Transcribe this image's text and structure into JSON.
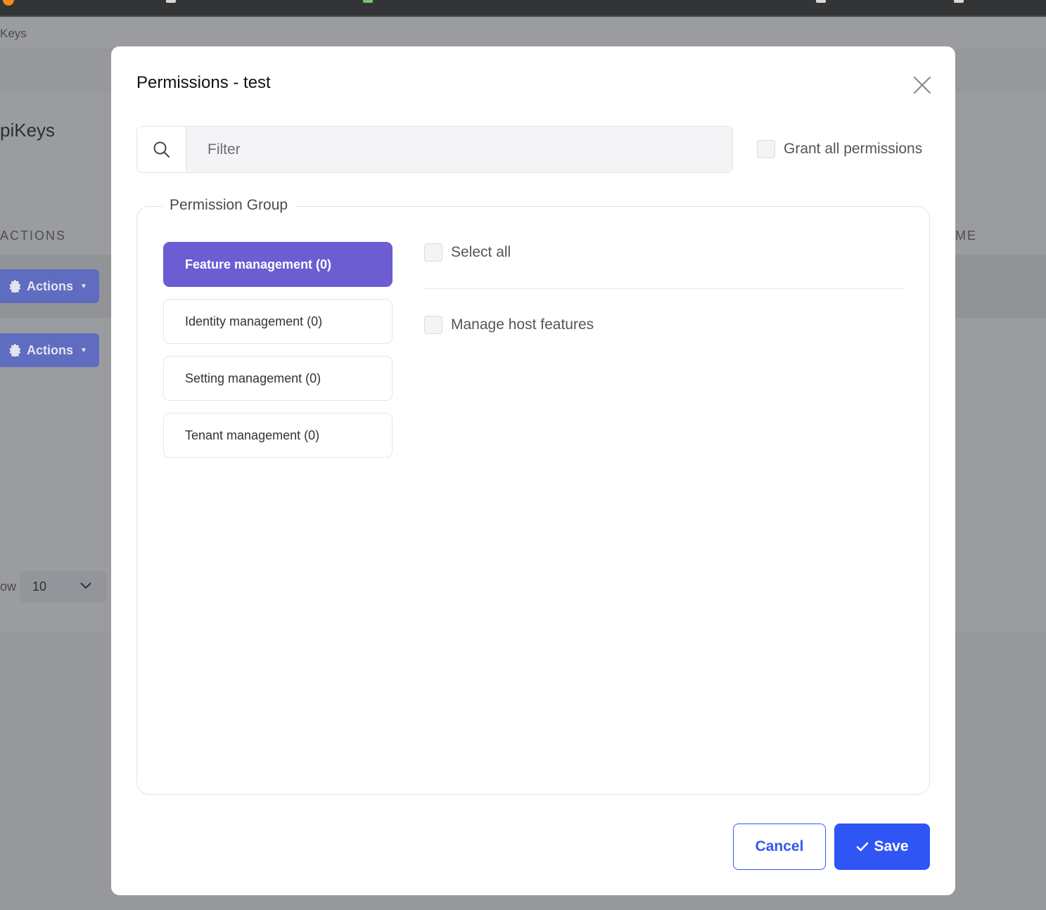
{
  "background": {
    "breadcrumb": "Keys",
    "page_title": "piKeys",
    "col_actions": "ACTIONS",
    "col_name": "ME",
    "actions_label": "Actions",
    "show_label": "ow",
    "page_size": "10"
  },
  "modal": {
    "title": "Permissions - test",
    "filter_placeholder": "Filter",
    "grant_all_label": "Grant all permissions",
    "legend": "Permission Group",
    "groups": [
      {
        "label": "Feature management (0)",
        "active": true
      },
      {
        "label": "Identity management (0)",
        "active": false
      },
      {
        "label": "Setting management (0)",
        "active": false
      },
      {
        "label": "Tenant management (0)",
        "active": false
      }
    ],
    "select_all_label": "Select all",
    "permissions": [
      {
        "label": "Manage host features",
        "checked": false
      }
    ],
    "cancel_label": "Cancel",
    "save_label": "Save"
  },
  "colors": {
    "accent": "#6c5dd3",
    "primary": "#2f55f5",
    "overlay": "#9b9ca0"
  }
}
